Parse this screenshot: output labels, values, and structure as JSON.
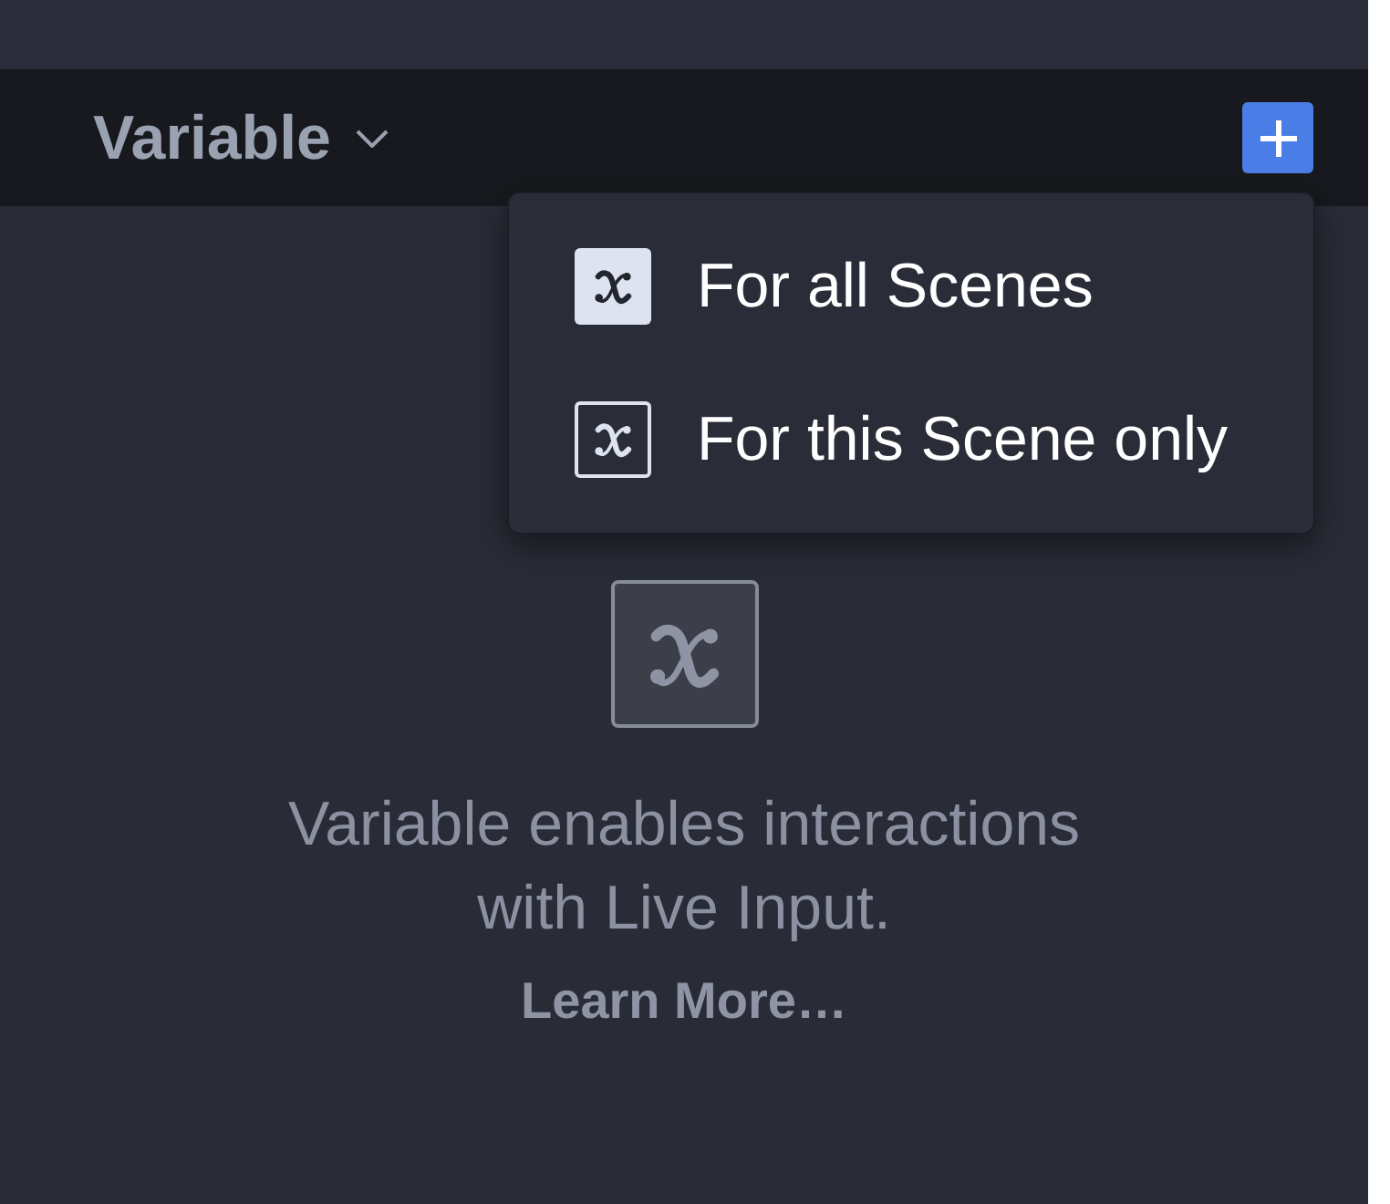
{
  "header": {
    "title": "Variable"
  },
  "add_menu": {
    "items": [
      {
        "label": "For all Scenes",
        "kind": "filled"
      },
      {
        "label": "For this Scene only",
        "kind": "outlined"
      }
    ]
  },
  "empty_state": {
    "message": "Variable enables interactions with Live Input.",
    "link": "Learn More…"
  }
}
